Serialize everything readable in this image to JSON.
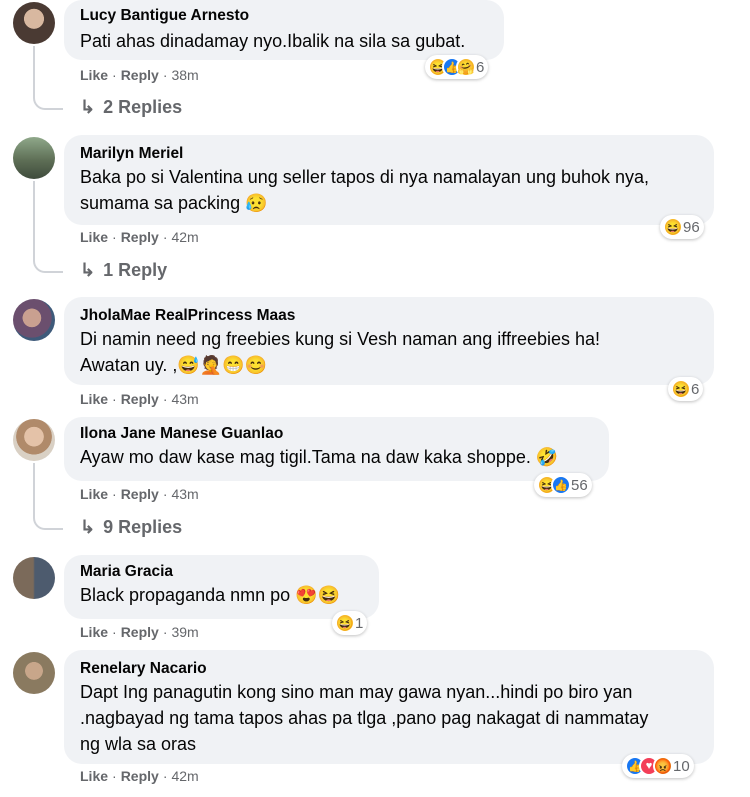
{
  "comments": [
    {
      "author": "Lucy Bantigue Arnesto",
      "lines": [
        "Pati ahas dinadamay nyo.Ibalik na sila sa gubat."
      ],
      "like_label": "Like",
      "reply_label": "Reply",
      "time": "38m",
      "reaction_count": "6",
      "reactions": [
        "haha-icon",
        "like-icon",
        "care-icon"
      ],
      "replies_label": "2 Replies"
    },
    {
      "author": "Marilyn Meriel",
      "lines": [
        "Baka po si Valentina ung seller tapos di nya namalayan ung buhok nya,",
        "sumama sa packing 😥"
      ],
      "like_label": "Like",
      "reply_label": "Reply",
      "time": "42m",
      "reaction_count": "96",
      "reactions": [
        "haha-icon"
      ],
      "replies_label": "1 Reply"
    },
    {
      "author": "JholaMae RealPrincess Maas",
      "lines": [
        "Di namin need ng freebies kung si Vesh naman ang iffreebies ha!",
        "Awatan uy. ,😅🤦😁😊"
      ],
      "like_label": "Like",
      "reply_label": "Reply",
      "time": "43m",
      "reaction_count": "6",
      "reactions": [
        "haha-icon"
      ]
    },
    {
      "author": "Ilona Jane Manese Guanlao",
      "lines": [
        "Ayaw mo daw kase mag tigil.Tama na daw kaka shoppe. 🤣"
      ],
      "like_label": "Like",
      "reply_label": "Reply",
      "time": "43m",
      "reaction_count": "56",
      "reactions": [
        "haha-icon",
        "like-icon"
      ],
      "replies_label": "9 Replies"
    },
    {
      "author": "Maria Gracia",
      "lines": [
        "Black propaganda nmn po 😍😆"
      ],
      "like_label": "Like",
      "reply_label": "Reply",
      "time": "39m",
      "reaction_count": "1",
      "reactions": [
        "haha-icon"
      ]
    },
    {
      "author": "Renelary Nacario",
      "lines": [
        "Dapt Ing panagutin kong sino man may gawa nyan...hindi po biro yan",
        ".nagbayad ng tama tapos ahas pa tlga ,pano pag nakagat di nammatay",
        "ng wla sa oras"
      ],
      "like_label": "Like",
      "reply_label": "Reply",
      "time": "42m",
      "reaction_count": "10",
      "reactions": [
        "like-icon",
        "heart-icon",
        "angry-icon"
      ]
    }
  ],
  "colors": {
    "bubble": "#f0f2f5",
    "secondary_text": "#65676b",
    "like_blue": "#1877f2",
    "haha_yellow": "#f7b928"
  }
}
